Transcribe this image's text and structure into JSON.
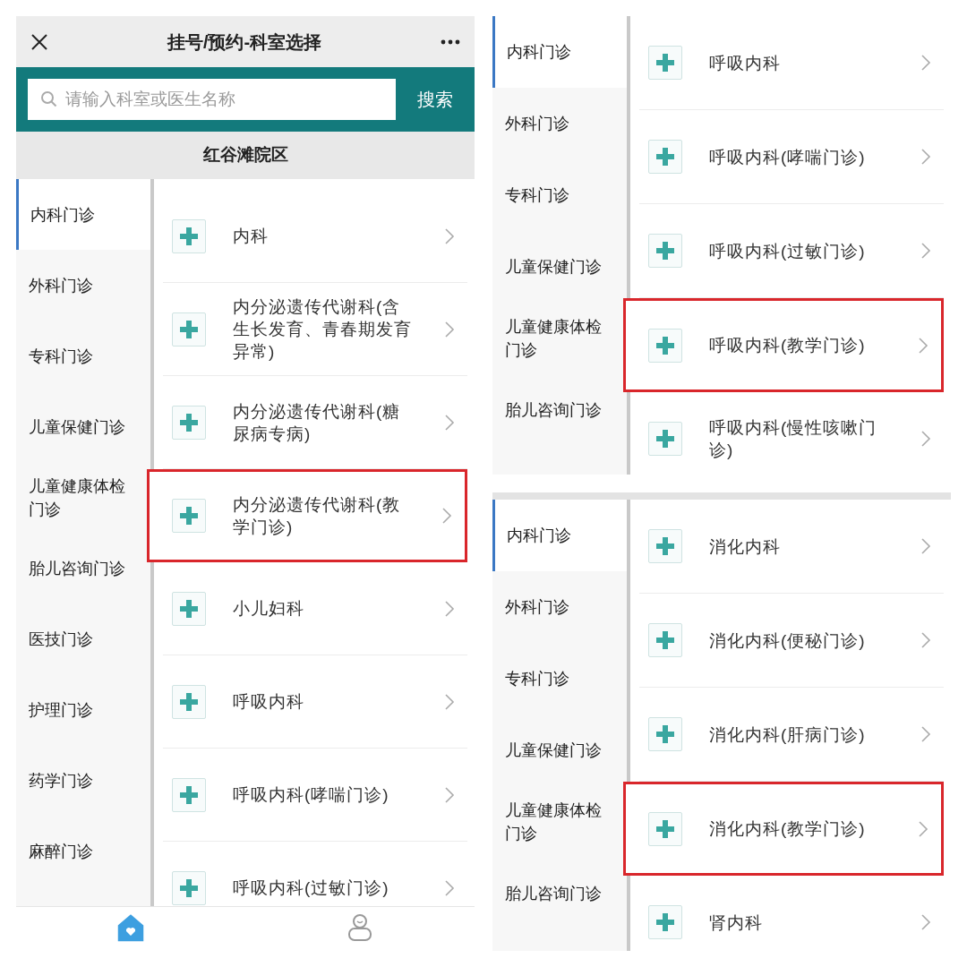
{
  "screens": [
    {
      "kind": "full",
      "title": "挂号/预约-科室选择",
      "search": {
        "placeholder": "请输入科室或医生名称",
        "button": "搜索"
      },
      "campus": "红谷滩院区",
      "sidebar": [
        {
          "label": "内科门诊",
          "selected": true
        },
        {
          "label": "外科门诊",
          "selected": false
        },
        {
          "label": "专科门诊",
          "selected": false
        },
        {
          "label": "儿童保健门诊",
          "selected": false
        },
        {
          "label": "儿童健康体检门诊",
          "selected": false
        },
        {
          "label": "胎儿咨询门诊",
          "selected": false
        },
        {
          "label": "医技门诊",
          "selected": false
        },
        {
          "label": "护理门诊",
          "selected": false
        },
        {
          "label": "药学门诊",
          "selected": false
        },
        {
          "label": "麻醉门诊",
          "selected": false
        }
      ],
      "departments": [
        {
          "name": "内科",
          "highlighted": false
        },
        {
          "name": "内分泌遗传代谢科(含生长发育、青春期发育异常)",
          "highlighted": false
        },
        {
          "name": "内分泌遗传代谢科(糖尿病专病)",
          "highlighted": false
        },
        {
          "name": "内分泌遗传代谢科(教学门诊)",
          "highlighted": true
        },
        {
          "name": "小儿妇科",
          "highlighted": false
        },
        {
          "name": "呼吸内科",
          "highlighted": false
        },
        {
          "name": "呼吸内科(哮喘门诊)",
          "highlighted": false
        },
        {
          "name": "呼吸内科(过敏门诊)",
          "highlighted": false
        }
      ],
      "tabs": [
        {
          "kind": "home",
          "selected": true
        },
        {
          "kind": "person",
          "selected": false
        }
      ]
    },
    {
      "kind": "list",
      "sidebar": [
        {
          "label": "内科门诊",
          "selected": true
        },
        {
          "label": "外科门诊",
          "selected": false
        },
        {
          "label": "专科门诊",
          "selected": false
        },
        {
          "label": "儿童保健门诊",
          "selected": false
        },
        {
          "label": "儿童健康体检门诊",
          "selected": false
        },
        {
          "label": "胎儿咨询门诊",
          "selected": false
        }
      ],
      "departments": [
        {
          "name": "呼吸内科",
          "highlighted": false
        },
        {
          "name": "呼吸内科(哮喘门诊)",
          "highlighted": false
        },
        {
          "name": "呼吸内科(过敏门诊)",
          "highlighted": false
        },
        {
          "name": "呼吸内科(教学门诊)",
          "highlighted": true
        },
        {
          "name": "呼吸内科(慢性咳嗽门诊)",
          "highlighted": false
        }
      ]
    },
    {
      "kind": "list",
      "sidebar": [
        {
          "label": "内科门诊",
          "selected": true
        },
        {
          "label": "外科门诊",
          "selected": false
        },
        {
          "label": "专科门诊",
          "selected": false
        },
        {
          "label": "儿童保健门诊",
          "selected": false
        },
        {
          "label": "儿童健康体检门诊",
          "selected": false
        },
        {
          "label": "胎儿咨询门诊",
          "selected": false
        }
      ],
      "departments": [
        {
          "name": "消化内科",
          "highlighted": false
        },
        {
          "name": "消化内科(便秘门诊)",
          "highlighted": false
        },
        {
          "name": "消化内科(肝病门诊)",
          "highlighted": false
        },
        {
          "name": "消化内科(教学门诊)",
          "highlighted": true
        },
        {
          "name": "肾内科",
          "highlighted": false
        }
      ]
    }
  ]
}
